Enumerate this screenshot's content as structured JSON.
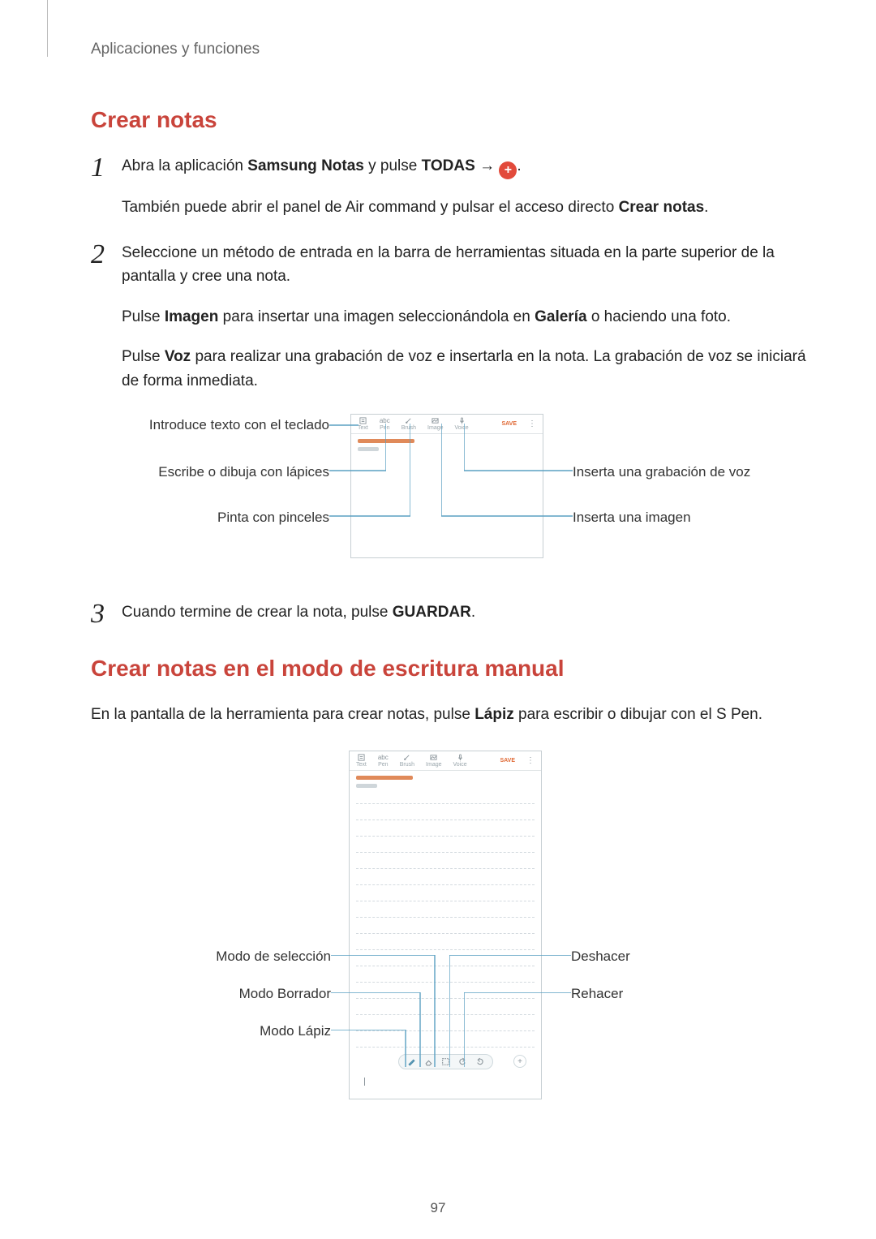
{
  "breadcrumb": "Aplicaciones y funciones",
  "page_number": "97",
  "section1": {
    "heading": "Crear notas",
    "step1": {
      "num": "1",
      "line1_a": "Abra la aplicación ",
      "line1_b": "Samsung Notas",
      "line1_c": " y pulse ",
      "line1_d": "TODAS",
      "line1_e": " → ",
      "line2_a": "También puede abrir el panel de Air command y pulsar el acceso directo ",
      "line2_b": "Crear notas",
      "line2_c": "."
    },
    "step2": {
      "num": "2",
      "p1": "Seleccione un método de entrada en la barra de herramientas situada en la parte superior de la pantalla y cree una nota.",
      "p2_a": "Pulse ",
      "p2_b": "Imagen",
      "p2_c": " para insertar una imagen seleccionándola en ",
      "p2_d": "Galería",
      "p2_e": " o haciendo una foto.",
      "p3_a": "Pulse ",
      "p3_b": "Voz",
      "p3_c": " para realizar una grabación de voz e insertarla en la nota. La grabación de voz se iniciará de forma inmediata."
    },
    "step3": {
      "num": "3",
      "p_a": "Cuando termine de crear la nota, pulse ",
      "p_b": "GUARDAR",
      "p_c": "."
    }
  },
  "diagram1": {
    "toolbar_labels": [
      "Text",
      "Pen",
      "Brush",
      "Image",
      "Voice"
    ],
    "save_label": "SAVE",
    "callouts_left": [
      "Introduce texto con el teclado",
      "Escribe o dibuja con lápices",
      "Pinta con pinceles"
    ],
    "callouts_right": [
      "Inserta una grabación de voz",
      "Inserta una imagen"
    ]
  },
  "section2": {
    "heading": "Crear notas en el modo de escritura manual",
    "p_a": "En la pantalla de la herramienta para crear notas, pulse ",
    "p_b": "Lápiz",
    "p_c": " para escribir o dibujar con el S Pen."
  },
  "diagram2": {
    "toolbar_labels": [
      "Text",
      "Pen",
      "Brush",
      "Image",
      "Voice"
    ],
    "save_label": "SAVE",
    "callouts_left": [
      "Modo de selección",
      "Modo Borrador",
      "Modo Lápiz"
    ],
    "callouts_right": [
      "Deshacer",
      "Rehacer"
    ]
  }
}
